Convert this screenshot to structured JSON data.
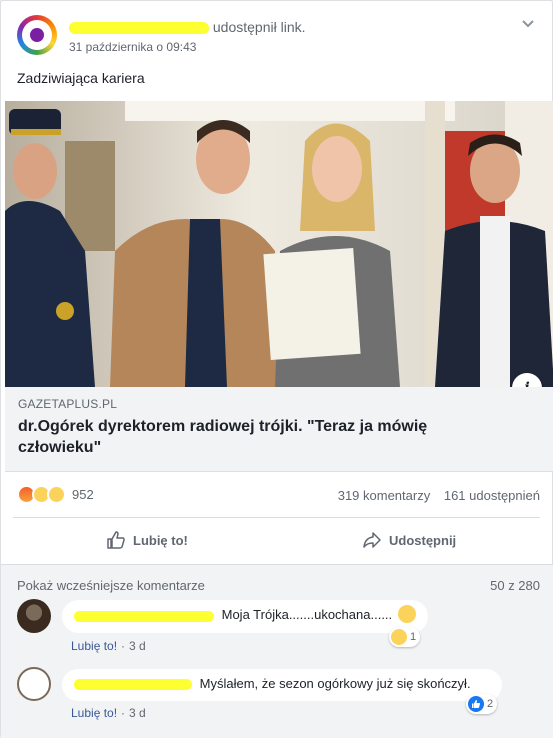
{
  "post": {
    "author_action": "udostępnił link.",
    "timestamp": "31 października o 09:43",
    "text": "Zadziwiająca kariera",
    "icons": {
      "menu": "chevron-down-icon",
      "info": "info-icon"
    }
  },
  "link": {
    "domain": "GAZETAPLUS.PL",
    "title": "dr.Ogórek dyrektorem radiowej trójki. \"Teraz ja mówię człowieku\"",
    "info_glyph": "i"
  },
  "stats": {
    "reaction_count": "952",
    "comments": "319 komentarzy",
    "shares": "161 udostępnień",
    "reaction_icons": [
      "angry-emoji-icon",
      "haha-emoji-icon",
      "sad-emoji-icon"
    ]
  },
  "actions": {
    "like": "Lubię to!",
    "share": "Udostępnij"
  },
  "comments_section": {
    "more_label": "Pokaż wcześniejsze komentarze",
    "counter": "50 z 280",
    "items": [
      {
        "text": "Moja Trójka.......ukochana......",
        "like_label": "Lubię to!",
        "age": "3 d",
        "reaction_count": "1",
        "reaction_icon": "sad-emoji-icon"
      },
      {
        "text": "Myślałem, że sezon ogórkowy już się skończył.",
        "like_label": "Lubię to!",
        "age": "3 d",
        "reaction_count": "2",
        "reaction_icon": "like-icon"
      }
    ]
  },
  "colors": {
    "link_blue": "#385898",
    "text_gray": "#606770",
    "redaction_yellow": "#fdff31",
    "comment_bg": "#f2f3f5"
  }
}
